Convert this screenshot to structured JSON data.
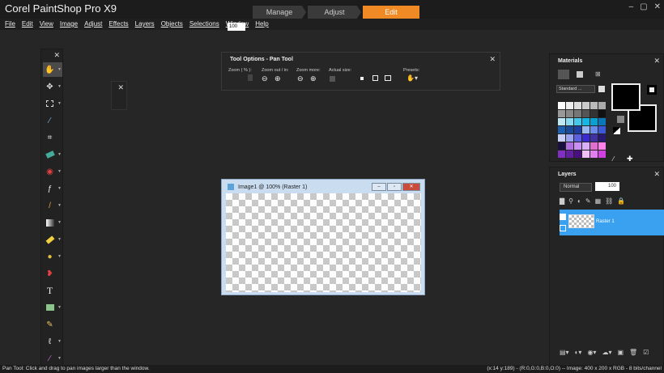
{
  "app": {
    "title": "Corel PaintShop Pro X9",
    "modes": [
      "Manage",
      "Adjust",
      "Edit"
    ],
    "window_controls": [
      "–",
      "▢",
      "✕"
    ]
  },
  "menu": [
    "File",
    "Edit",
    "View",
    "Image",
    "Adjust",
    "Effects",
    "Layers",
    "Objects",
    "Selections",
    "Window",
    "Help"
  ],
  "tool_options": {
    "title": "Tool Options - Pan Tool",
    "zoom_label": "Zoom ( % ):",
    "zoom_value": "100",
    "zoom_out_in_label": "Zoom out / in:",
    "zoom_more_label": "Zoom more:",
    "actual_size_label": "Actual size:",
    "presets_label": "Presets:"
  },
  "image_window": {
    "title": "Image1 @ 100% (Raster 1)"
  },
  "materials": {
    "title": "Materials",
    "standard_label": "Standard ...",
    "swatches": [
      "#ffffff",
      "#eeeeee",
      "#dddddd",
      "#cccccc",
      "#bbbbbb",
      "#aaaaaa",
      "#999999",
      "#888888",
      "#777777",
      "#555555",
      "#333333",
      "#111111",
      "#bfeaf5",
      "#88dbf0",
      "#45c8ec",
      "#17b6e3",
      "#0aa0d0",
      "#0a78b8",
      "#1e60b0",
      "#1a4b98",
      "#1e3fa0",
      "#9ab8f0",
      "#6a8ce8",
      "#3c5ad8",
      "#c8d0f8",
      "#98a4f0",
      "#5a60e0",
      "#3a2ad0",
      "#4030a0",
      "#281a70",
      "#1a1040",
      "#b070e0",
      "#c890f0",
      "#d8b0f8",
      "#e070d0",
      "#ff80e8",
      "#8030c0",
      "#6020a0",
      "#4a1080",
      "#f0c0f8",
      "#e080f0",
      "#d040e0"
    ]
  },
  "layers": {
    "title": "Layers",
    "blend_mode": "Normal",
    "opacity": "100",
    "layer_name": "Raster 1"
  },
  "status": {
    "left": "Pan Tool: Click and drag to pan images larger than the window.",
    "right": "(x:14 y:189) - (R:0,G:0,B:0,O:0) -- Image:  400 x 200 x RGB - 8 bits/channel"
  }
}
